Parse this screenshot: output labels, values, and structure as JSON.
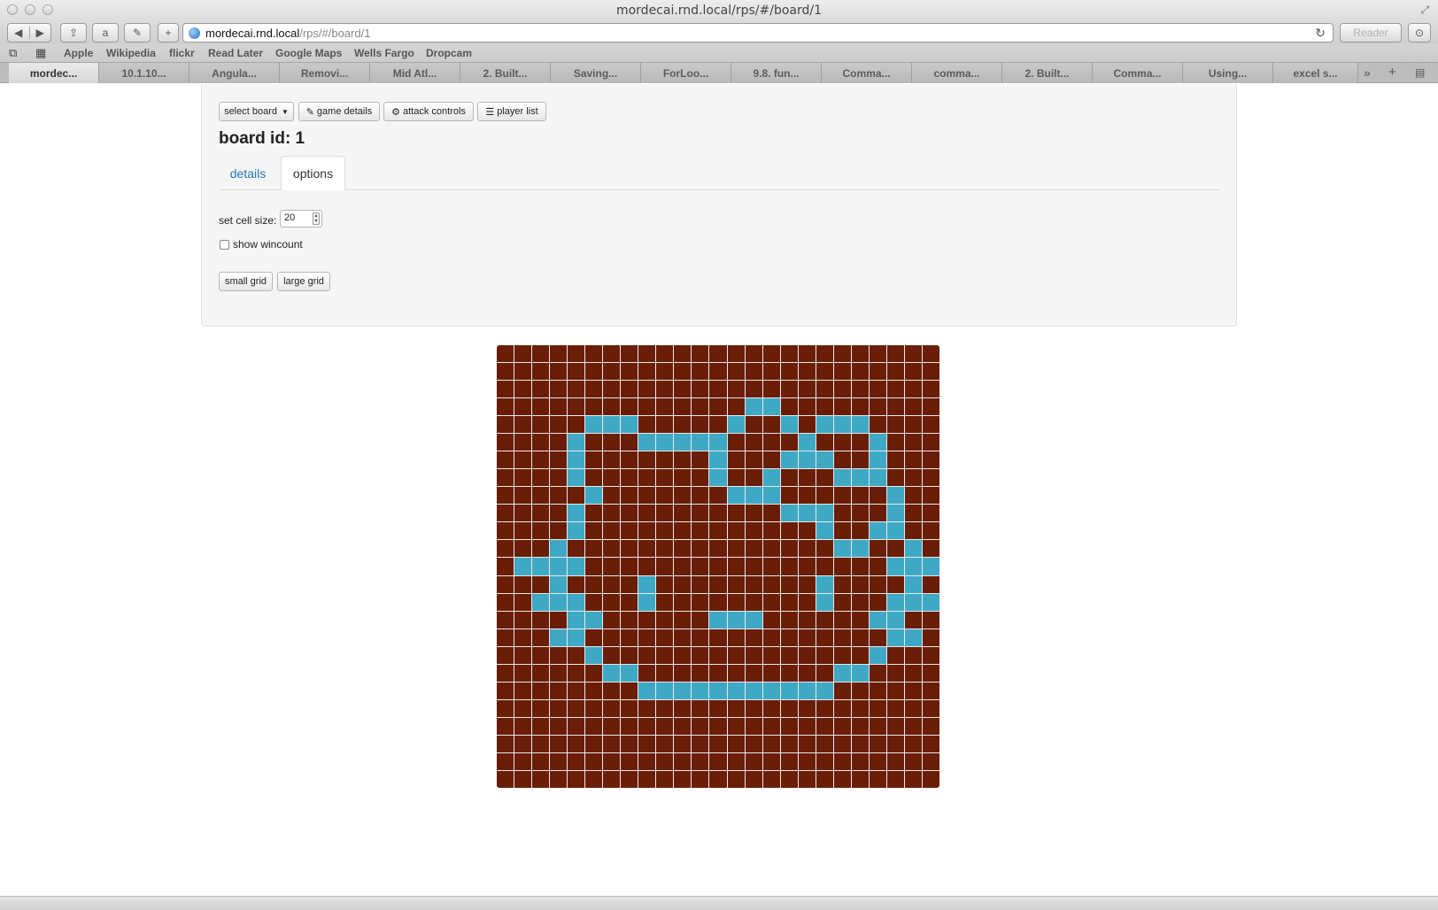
{
  "window": {
    "title": "mordecai.rnd.local/rps/#/board/1"
  },
  "toolbar": {
    "back_icon": "◀",
    "forward_icon": "▶",
    "share_icon": "⇪",
    "amazon_icon": "a",
    "tool_icon": "✎",
    "add_icon": "+",
    "url_host": "mordecai.rnd.local",
    "url_path": "/rps/#/board/1",
    "reload_icon": "↻",
    "reader_label": "Reader",
    "download_icon": "⊙"
  },
  "bookmarks": {
    "reading_list_icon": "📖",
    "top_sites_icon": "▦",
    "items": [
      "Apple",
      "Wikipedia",
      "flickr",
      "Read Later",
      "Google Maps",
      "Wells Fargo",
      "Dropcam"
    ]
  },
  "tabs": {
    "items": [
      "mordec...",
      "10.1.10...",
      "Angula...",
      "Removi...",
      "Mid Atl...",
      "2. Built...",
      "Saving...",
      "ForLoo...",
      "9.8. fun...",
      "Comma...",
      "comma...",
      "2. Built...",
      "Comma...",
      "Using...",
      "excel s..."
    ],
    "more_icon": "»",
    "add_icon": "+",
    "grid_icon": "▤"
  },
  "page": {
    "buttons": {
      "select_board": "select board",
      "game_details": "game details",
      "attack_controls": "attack controls",
      "player_list": "player list"
    },
    "icons": {
      "caret": "▼",
      "tag": "✎",
      "gear": "⚙",
      "list": "☰"
    },
    "board_title": "board id: 1",
    "tabs": {
      "details": "details",
      "options": "options"
    },
    "cell_size_label": "set cell size:",
    "cell_size_value": "20",
    "stepper_icon": "⇕",
    "wincount_label": "show wincount",
    "wincount_checked": false,
    "small_grid": "small grid",
    "large_grid": "large grid"
  },
  "board": {
    "rows": 25,
    "cols": 25,
    "colors": {
      "off": "#6a1e07",
      "on": "#3fa9c5",
      "grid": "#e9e9e9"
    },
    "highlighted": [
      [
        3,
        14
      ],
      [
        3,
        15
      ],
      [
        4,
        5
      ],
      [
        4,
        6
      ],
      [
        4,
        7
      ],
      [
        4,
        13
      ],
      [
        4,
        16
      ],
      [
        4,
        18
      ],
      [
        4,
        19
      ],
      [
        4,
        20
      ],
      [
        5,
        4
      ],
      [
        5,
        8
      ],
      [
        5,
        9
      ],
      [
        5,
        10
      ],
      [
        5,
        11
      ],
      [
        5,
        12
      ],
      [
        5,
        17
      ],
      [
        5,
        21
      ],
      [
        6,
        4
      ],
      [
        6,
        12
      ],
      [
        6,
        16
      ],
      [
        6,
        17
      ],
      [
        6,
        18
      ],
      [
        6,
        21
      ],
      [
        7,
        4
      ],
      [
        7,
        12
      ],
      [
        7,
        15
      ],
      [
        7,
        19
      ],
      [
        7,
        20
      ],
      [
        7,
        21
      ],
      [
        8,
        5
      ],
      [
        8,
        13
      ],
      [
        8,
        14
      ],
      [
        8,
        15
      ],
      [
        8,
        22
      ],
      [
        9,
        4
      ],
      [
        9,
        16
      ],
      [
        9,
        17
      ],
      [
        9,
        18
      ],
      [
        9,
        22
      ],
      [
        10,
        4
      ],
      [
        10,
        18
      ],
      [
        10,
        21
      ],
      [
        10,
        22
      ],
      [
        11,
        3
      ],
      [
        11,
        19
      ],
      [
        11,
        20
      ],
      [
        11,
        23
      ],
      [
        12,
        1
      ],
      [
        12,
        2
      ],
      [
        12,
        3
      ],
      [
        12,
        4
      ],
      [
        12,
        22
      ],
      [
        12,
        23
      ],
      [
        12,
        24
      ],
      [
        13,
        3
      ],
      [
        13,
        8
      ],
      [
        13,
        18
      ],
      [
        13,
        23
      ],
      [
        14,
        2
      ],
      [
        14,
        3
      ],
      [
        14,
        4
      ],
      [
        14,
        8
      ],
      [
        14,
        18
      ],
      [
        14,
        22
      ],
      [
        14,
        23
      ],
      [
        14,
        24
      ],
      [
        15,
        4
      ],
      [
        15,
        5
      ],
      [
        15,
        12
      ],
      [
        15,
        13
      ],
      [
        15,
        14
      ],
      [
        15,
        21
      ],
      [
        15,
        22
      ],
      [
        16,
        3
      ],
      [
        16,
        4
      ],
      [
        16,
        22
      ],
      [
        16,
        23
      ],
      [
        17,
        5
      ],
      [
        17,
        21
      ],
      [
        18,
        6
      ],
      [
        18,
        7
      ],
      [
        18,
        19
      ],
      [
        18,
        20
      ],
      [
        19,
        8
      ],
      [
        19,
        9
      ],
      [
        19,
        10
      ],
      [
        19,
        11
      ],
      [
        19,
        12
      ],
      [
        19,
        13
      ],
      [
        19,
        14
      ],
      [
        19,
        15
      ],
      [
        19,
        16
      ],
      [
        19,
        17
      ],
      [
        19,
        18
      ]
    ]
  }
}
